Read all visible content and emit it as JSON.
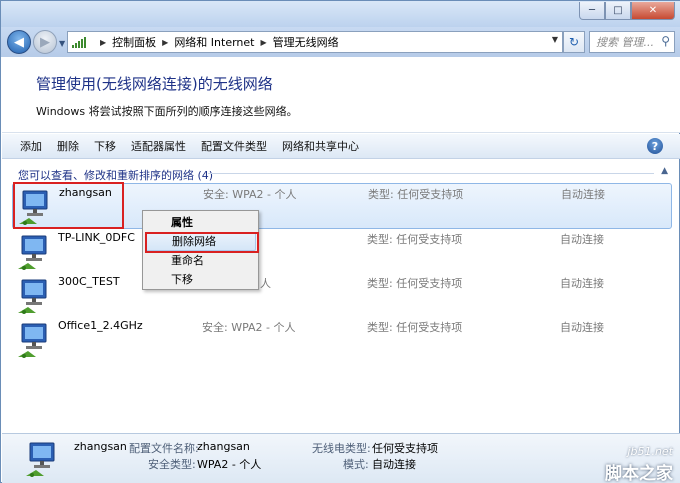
{
  "window": {
    "controls": [
      "─",
      "□",
      "✕"
    ]
  },
  "nav": {
    "back": "◀",
    "forward": "▶",
    "breadcrumb": [
      "控制面板",
      "网络和 Internet",
      "管理无线网络"
    ],
    "breadcrumb_sep": "▶",
    "search_placeholder": "搜索 管理...",
    "refresh": "↻"
  },
  "header": {
    "title": "管理使用(无线网络连接)的无线网络",
    "subtitle": "Windows 将尝试按照下面所列的顺序连接这些网络。"
  },
  "toolbar": {
    "items": [
      "添加",
      "删除",
      "下移",
      "适配器属性",
      "配置文件类型",
      "网络和共享中心"
    ],
    "help": "?"
  },
  "group": {
    "label": "您可以查看、修改和重新排序的网络 (4)",
    "collapse": "▲"
  },
  "networks": [
    {
      "name": "zhangsan",
      "security": "安全: WPA2 - 个人",
      "type": "类型: 任何受支持项",
      "mode": "自动连接"
    },
    {
      "name": "TP-LINK_0DFC",
      "security": "",
      "type": "类型: 任何受支持项",
      "mode": "自动连接"
    },
    {
      "name": "300C_TEST",
      "security": "人",
      "type": "类型: 任何受支持项",
      "mode": "自动连接"
    },
    {
      "name": "Office1_2.4GHz",
      "security": "安全: WPA2 - 个人",
      "type": "类型: 任何受支持项",
      "mode": "自动连接"
    }
  ],
  "context_menu": {
    "items": [
      "属性",
      "删除网络",
      "重命名",
      "下移"
    ]
  },
  "details": {
    "name": "zhangsan",
    "profile_label": "配置文件名称:",
    "profile_value": "zhangsan",
    "radio_label": "无线电类型:",
    "radio_value": "任何受支持项",
    "security_label": "安全类型:",
    "security_value": "WPA2 - 个人",
    "mode_label": "模式:",
    "mode_value": "自动连接"
  },
  "watermark": {
    "site": "jb51.net",
    "brand": "脚本之家"
  }
}
